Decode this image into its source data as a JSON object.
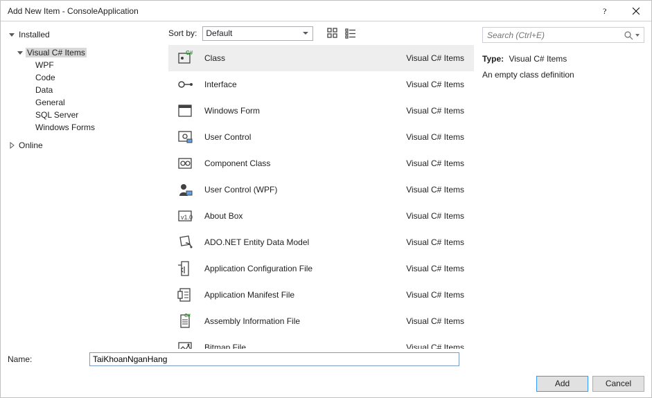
{
  "window": {
    "title": "Add New Item - ConsoleApplication"
  },
  "tree": {
    "installed_label": "Installed",
    "csharp_items_label": "Visual C# Items",
    "sub": {
      "wpf": "WPF",
      "code": "Code",
      "data": "Data",
      "general": "General",
      "sql": "SQL Server",
      "winforms": "Windows Forms"
    },
    "online_label": "Online"
  },
  "sort": {
    "label": "Sort by:",
    "value": "Default"
  },
  "templates": [
    {
      "name": "Class",
      "category": "Visual C# Items",
      "selected": true
    },
    {
      "name": "Interface",
      "category": "Visual C# Items"
    },
    {
      "name": "Windows Form",
      "category": "Visual C# Items"
    },
    {
      "name": "User Control",
      "category": "Visual C# Items"
    },
    {
      "name": "Component Class",
      "category": "Visual C# Items"
    },
    {
      "name": "User Control (WPF)",
      "category": "Visual C# Items"
    },
    {
      "name": "About Box",
      "category": "Visual C# Items"
    },
    {
      "name": "ADO.NET Entity Data Model",
      "category": "Visual C# Items"
    },
    {
      "name": "Application Configuration File",
      "category": "Visual C# Items"
    },
    {
      "name": "Application Manifest File",
      "category": "Visual C# Items"
    },
    {
      "name": "Assembly Information File",
      "category": "Visual C# Items"
    },
    {
      "name": "Bitmap File",
      "category": "Visual C# Items"
    }
  ],
  "search": {
    "placeholder": "Search (Ctrl+E)"
  },
  "details": {
    "type_label": "Type:",
    "type_value": "Visual C# Items",
    "description": "An empty class definition"
  },
  "name_field": {
    "label": "Name:",
    "value": "TaiKhoanNganHang"
  },
  "footer": {
    "add": "Add",
    "cancel": "Cancel"
  }
}
